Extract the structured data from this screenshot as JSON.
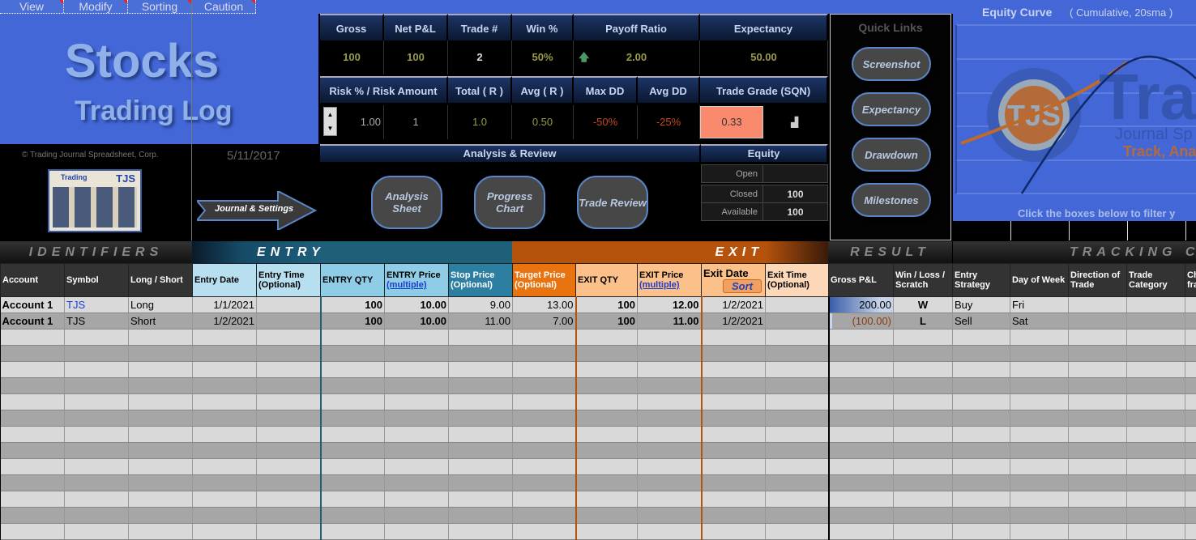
{
  "menu": [
    "View",
    "Modify",
    "Sorting",
    "Caution"
  ],
  "title": {
    "line1": "Stocks",
    "line2": "Trading Log"
  },
  "copyright": "© Trading Journal Spreadsheet, Corp.",
  "date": "5/11/2017",
  "thumb": {
    "brand": "Trading",
    "short": "TJS"
  },
  "journal_button": "Journal & Settings",
  "stats1": {
    "headers": [
      "Gross",
      "Net P&L",
      "Trade #",
      "Win %",
      "Payoff Ratio",
      "Expectancy"
    ],
    "values": [
      "100",
      "100",
      "2",
      "50%",
      "2.00",
      "50.00"
    ]
  },
  "stats2": {
    "headers": [
      "Risk %  /  Risk Amount",
      "Total ( R )",
      "Avg ( R )",
      "Max DD",
      "Avg DD",
      "Trade Grade (SQN)"
    ],
    "risk_pct": "1.00",
    "risk_amount": "1",
    "total_r": "1.0",
    "avg_r": "0.50",
    "max_dd": "-50%",
    "avg_dd": "-25%",
    "sqn": "0.33"
  },
  "analysis": {
    "title": "Analysis & Review",
    "buttons": [
      "Analysis Sheet",
      "Progress Chart",
      "Trade Review"
    ]
  },
  "equity": {
    "title": "Equity",
    "rows": [
      {
        "label": "Open",
        "value": ""
      },
      {
        "label": "Closed",
        "value": "100"
      },
      {
        "label": "Available",
        "value": "100"
      }
    ]
  },
  "quick_links": {
    "title": "Quick Links",
    "buttons": [
      "Screenshot",
      "Expectancy",
      "Drawdown",
      "Milestones"
    ]
  },
  "equity_curve": {
    "title": "Equity Curve",
    "subtitle": "( Cumulative,  20sma )",
    "footer": "Click the boxes below to filter y",
    "logo": {
      "big": "Tra",
      "line2": "Journal Sp",
      "line3": "Track, Ana",
      "mark": "TJS"
    }
  },
  "sections": {
    "identifiers": "IDENTIFIERS",
    "entry": "ENTRY",
    "exit": "EXIT",
    "result": "RESULT",
    "tracking": "TRACKING CO"
  },
  "columns": [
    [
      "Account",
      ""
    ],
    [
      "Symbol",
      ""
    ],
    [
      "Long / Short",
      ""
    ],
    [
      "Entry Date",
      ""
    ],
    [
      "Entry Time",
      "(Optional)"
    ],
    [
      "ENTRY QTY",
      ""
    ],
    [
      "ENTRY Price",
      "(multiple)"
    ],
    [
      "Stop Price",
      "(Optional)"
    ],
    [
      "Target Price",
      "(Optional)"
    ],
    [
      "EXIT QTY",
      ""
    ],
    [
      "EXIT Price",
      "(multiple)"
    ],
    [
      "Exit Date",
      "Sort"
    ],
    [
      "Exit Time",
      "(Optional)"
    ],
    [
      "Gross P&L",
      ""
    ],
    [
      "Win / Loss /",
      "Scratch"
    ],
    [
      "Entry",
      "Strategy"
    ],
    [
      "Day of Week",
      ""
    ],
    [
      "Direction of",
      "Trade"
    ],
    [
      "Trade",
      "Category"
    ],
    [
      "Ch",
      "fra"
    ]
  ],
  "rows": [
    [
      "Account 1",
      "TJS",
      "Long",
      "1/1/2021",
      "",
      "100",
      "10.00",
      "9.00",
      "13.00",
      "100",
      "12.00",
      "1/2/2021",
      "",
      "200.00",
      "W",
      "Buy",
      "Fri",
      "",
      "",
      ""
    ],
    [
      "Account 1",
      "TJS",
      "Short",
      "1/2/2021",
      "",
      "100",
      "10.00",
      "11.00",
      "7.00",
      "100",
      "11.00",
      "1/2/2021",
      "",
      "(100.00)",
      "L",
      "Sell",
      "Sat",
      "",
      "",
      ""
    ]
  ],
  "colors": {
    "blue": "#4367d6",
    "entry": "#1e5f7a",
    "exit": "#b5520c",
    "sqn": "#fa8a6e"
  }
}
